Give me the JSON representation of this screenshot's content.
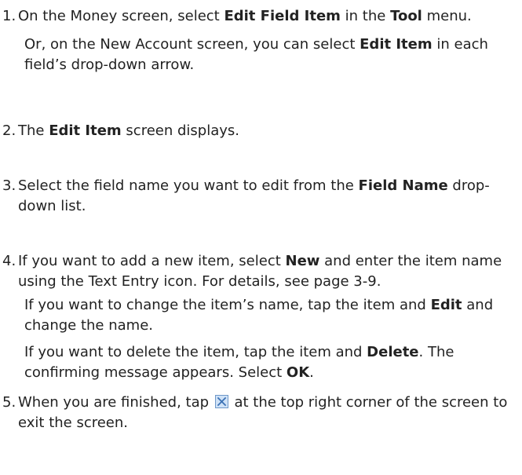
{
  "steps": [
    {
      "number": "1.",
      "parts": [
        {
          "t": "On the Money screen, select "
        },
        {
          "b": "Edit Field Item"
        },
        {
          "t": " in the "
        },
        {
          "b": "Tool"
        },
        {
          "t": " menu."
        }
      ],
      "sub": [
        [
          {
            "t": "Or, on the New Account screen, you can select "
          },
          {
            "b": "Edit Item"
          },
          {
            "t": " in each field’s drop-down arrow."
          }
        ]
      ]
    },
    {
      "number": "2.",
      "parts": [
        {
          "t": "The "
        },
        {
          "b": "Edit Item"
        },
        {
          "t": " screen displays."
        }
      ],
      "sub": []
    },
    {
      "number": "3.",
      "parts": [
        {
          "t": "Select the field name you want to edit from the "
        },
        {
          "b": "Field Name"
        },
        {
          "t": " drop-down list."
        }
      ],
      "sub": []
    },
    {
      "number": "4.",
      "parts": [
        {
          "t": "If you want to add a new item, select "
        },
        {
          "b": "New"
        },
        {
          "t": " and enter the item name using the Text Entry icon. For details, see page 3-9."
        }
      ],
      "sub": [
        [
          {
            "t": "If you want to change the item’s name, tap the item and "
          },
          {
            "b": "Edit"
          },
          {
            "t": " and change the name."
          }
        ],
        [
          {
            "t": "If you want to delete the item, tap the item and "
          },
          {
            "b": "Delete"
          },
          {
            "t": ". The confirming message appears. Select "
          },
          {
            "b": "OK"
          },
          {
            "t": "."
          }
        ]
      ]
    },
    {
      "number": "5.",
      "parts": [
        {
          "t": "When you are finished, tap "
        },
        {
          "icon": "close-icon"
        },
        {
          "t": " at the top right corner of the screen to exit the screen."
        }
      ],
      "sub": []
    }
  ],
  "colors": {
    "text": "#222222",
    "icon_bg": "#cfe2f7",
    "icon_border": "#6f98c8",
    "icon_x": "#3c72b5"
  }
}
